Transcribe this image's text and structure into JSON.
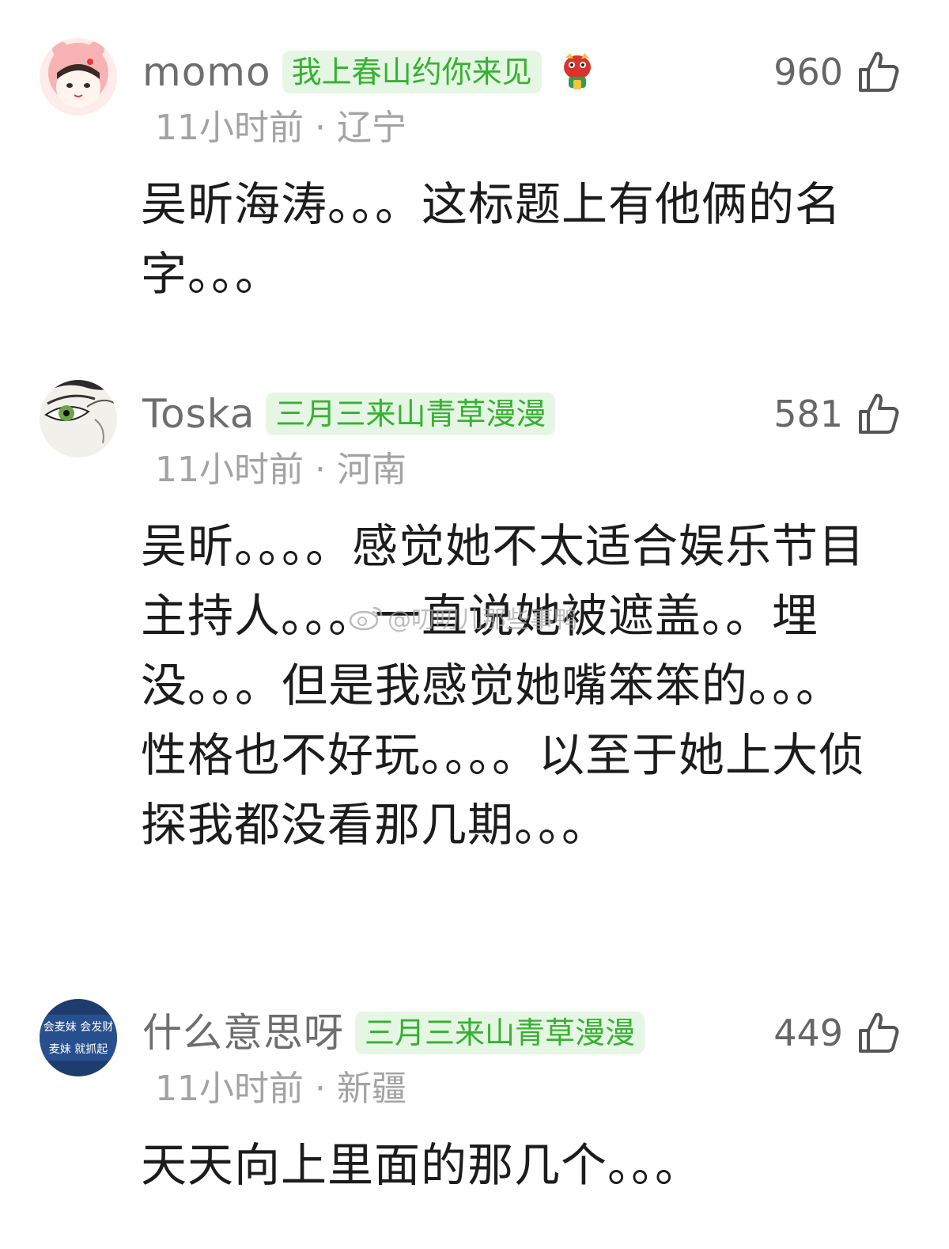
{
  "comments": [
    {
      "username": "momo",
      "badge": "我上春山约你来见",
      "time": "11小时前",
      "location": "辽宁",
      "likes": "960",
      "text": "吴昕海涛。。。这标题上有他俩的名字。。。"
    },
    {
      "username": "Toska",
      "badge": "三月三来山青草漫漫",
      "time": "11小时前",
      "location": "河南",
      "likes": "581",
      "text": "吴昕。。。。感觉她不太适合娱乐节目主持人。。。一直说她被遮盖。。埋没。。。但是我感觉她嘴笨笨的。。。性格也不好玩。。。。以至于她上大侦探我都没看那几期。。。"
    },
    {
      "username": "什么意思呀",
      "badge": "三月三来山青草漫漫",
      "time": "11小时前",
      "location": "新疆",
      "likes": "449",
      "text": "天天向上里面的那几个。。。",
      "avatar_text": [
        "会麦妹 会发财",
        "麦妹 就抓起"
      ]
    }
  ],
  "meta_separator": "·",
  "watermark": "@叨叨儿那些事鸭",
  "colors": {
    "badge_bg": "#e6f6e4",
    "badge_text": "#35b22f",
    "username": "#6e6e6e",
    "meta": "#a3a3a3",
    "body": "#1c1c1c"
  },
  "icons": {
    "like": "thumbs-up-icon",
    "sticker": "lion-dance-sticker-icon",
    "watermark": "weibo-logo-icon"
  }
}
